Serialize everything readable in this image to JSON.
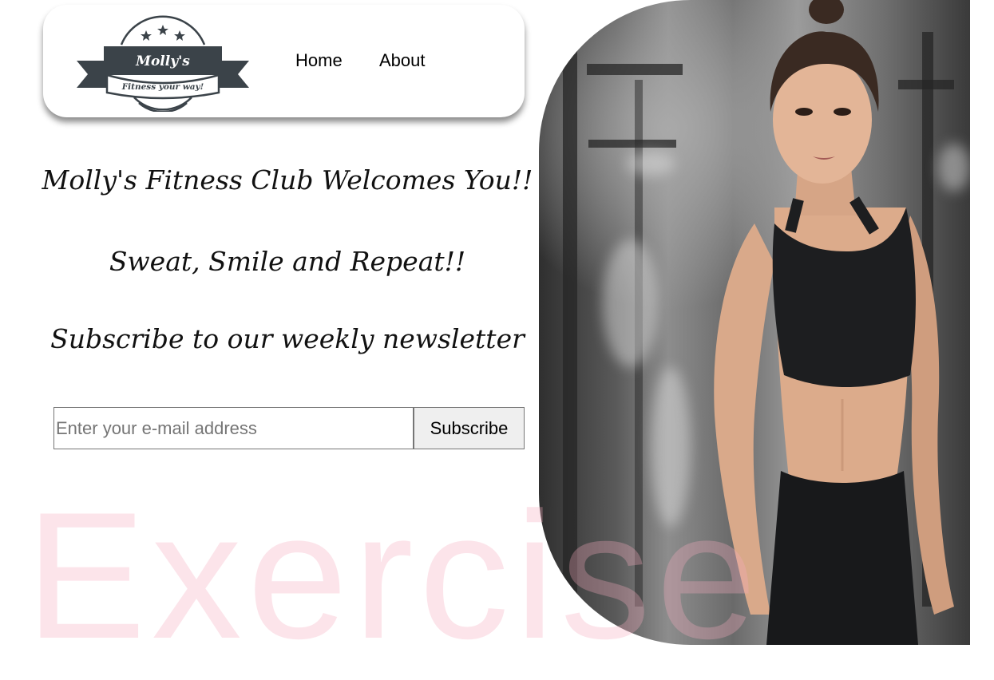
{
  "brand": {
    "name": "Molly's",
    "tagline": "Fitness your way!"
  },
  "nav": {
    "home": "Home",
    "about": "About"
  },
  "hero": {
    "welcome": "Molly's Fitness Club Welcomes You!!",
    "motto": "Sweat, Smile and Repeat!!",
    "subscribe_prompt": "Subscribe to our weekly newsletter"
  },
  "subscribe": {
    "placeholder": "Enter your e-mail address",
    "value": "",
    "button_label": "Subscribe"
  },
  "watermark": "Exercise",
  "colors": {
    "logo_banner": "#3b4349",
    "watermark": "#f6aabe",
    "button_bg": "#efefef"
  },
  "icons": {
    "logo_stars": "star-icon"
  }
}
